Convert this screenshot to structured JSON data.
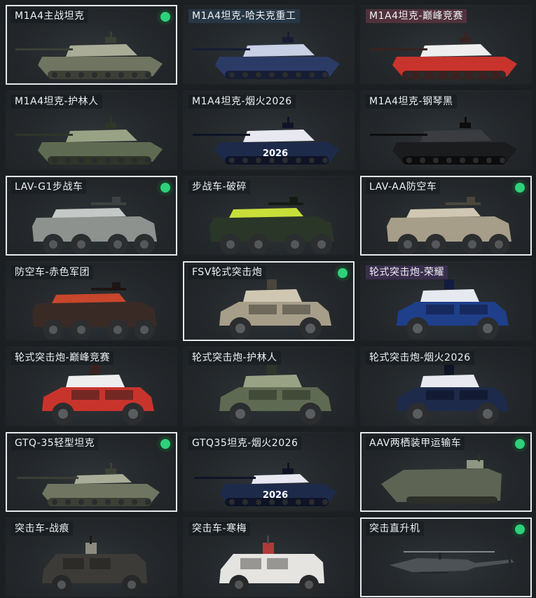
{
  "cards": [
    {
      "name": "M1A4主战坦克",
      "owned": true,
      "selected": true,
      "kind": "tank",
      "skin": "camo-green"
    },
    {
      "name": "M1A4坦克-哈夫克重工",
      "owned": false,
      "selected": false,
      "kind": "tank",
      "skin": "blue-stars",
      "tint": "blue"
    },
    {
      "name": "M1A4坦克-巅峰竞赛",
      "owned": false,
      "selected": false,
      "kind": "tank",
      "skin": "red-white",
      "tint": "pink"
    },
    {
      "name": "M1A4坦克-护林人",
      "owned": false,
      "selected": false,
      "kind": "tank",
      "skin": "forest"
    },
    {
      "name": "M1A4坦克-烟火2026",
      "owned": false,
      "selected": false,
      "kind": "tank",
      "skin": "fireworks",
      "badge": "2026"
    },
    {
      "name": "M1A4坦克-钢琴黑",
      "owned": false,
      "selected": false,
      "kind": "tank",
      "skin": "piano-black"
    },
    {
      "name": "LAV-G1步战车",
      "owned": true,
      "selected": true,
      "kind": "ifv",
      "skin": "grey"
    },
    {
      "name": "步战车-破碎",
      "owned": false,
      "selected": false,
      "kind": "ifv",
      "skin": "yellow-shatter"
    },
    {
      "name": "LAV-AA防空车",
      "owned": true,
      "selected": true,
      "kind": "ifv",
      "skin": "tan"
    },
    {
      "name": "防空车-赤色军团",
      "owned": false,
      "selected": false,
      "kind": "ifv",
      "skin": "red-legion"
    },
    {
      "name": "FSV轮式突击炮",
      "owned": true,
      "selected": true,
      "kind": "fsv",
      "skin": "tan"
    },
    {
      "name": "轮式突击炮-荣耀",
      "owned": false,
      "selected": false,
      "kind": "fsv",
      "skin": "blue-white",
      "tint": "purple"
    },
    {
      "name": "轮式突击炮-巅峰竞赛",
      "owned": false,
      "selected": false,
      "kind": "fsv",
      "skin": "red-white"
    },
    {
      "name": "轮式突击炮-护林人",
      "owned": false,
      "selected": false,
      "kind": "fsv",
      "skin": "forest"
    },
    {
      "name": "轮式突击炮-烟火2026",
      "owned": false,
      "selected": false,
      "kind": "fsv",
      "skin": "fireworks"
    },
    {
      "name": "GTQ-35轻型坦克",
      "owned": true,
      "selected": true,
      "kind": "light-tank",
      "skin": "camo-green"
    },
    {
      "name": "GTQ35坦克-烟火2026",
      "owned": false,
      "selected": false,
      "kind": "light-tank",
      "skin": "fireworks",
      "badge": "2026"
    },
    {
      "name": "AAV两栖装甲运输车",
      "owned": true,
      "selected": true,
      "kind": "aav",
      "skin": "green-grey"
    },
    {
      "name": "突击车-战痕",
      "owned": false,
      "selected": false,
      "kind": "assault",
      "skin": "scarred"
    },
    {
      "name": "突击车-寒梅",
      "owned": false,
      "selected": false,
      "kind": "assault",
      "skin": "white-plum"
    },
    {
      "name": "突击直升机",
      "owned": true,
      "selected": true,
      "kind": "heli",
      "skin": "dark-grey"
    }
  ],
  "skins": {
    "camo-green": {
      "body": "#6f7560",
      "accent": "#a9ad98",
      "dark": "#3c3f35"
    },
    "blue-stars": {
      "body": "#2c3a66",
      "accent": "#c8d0e6",
      "dark": "#161d34"
    },
    "red-white": {
      "body": "#c8342c",
      "accent": "#eeeeee",
      "dark": "#3a2220"
    },
    "forest": {
      "body": "#5f6a52",
      "accent": "#9aa286",
      "dark": "#2f3528"
    },
    "fireworks": {
      "body": "#1d2a4a",
      "accent": "#e8e8f0",
      "dark": "#0e1326"
    },
    "piano-black": {
      "body": "#1b1c1e",
      "accent": "#3a3c40",
      "dark": "#0c0c0d"
    },
    "grey": {
      "body": "#8d928f",
      "accent": "#c4c8c6",
      "dark": "#3e4240"
    },
    "yellow-shatter": {
      "body": "#2a3628",
      "accent": "#c8df3a",
      "dark": "#161c15"
    },
    "tan": {
      "body": "#a79e89",
      "accent": "#cfc7b2",
      "dark": "#4a463c"
    },
    "red-legion": {
      "body": "#3a2a26",
      "accent": "#c8462c",
      "dark": "#1e1614"
    },
    "blue-white": {
      "body": "#1f3f8a",
      "accent": "#e6e9ef",
      "dark": "#111d40"
    },
    "green-grey": {
      "body": "#5d6454",
      "accent": "#8f9683",
      "dark": "#2c3028"
    },
    "scarred": {
      "body": "#3c3b37",
      "accent": "#8d8a80",
      "dark": "#1c1b19"
    },
    "white-plum": {
      "body": "#e5e4e0",
      "accent": "#b03a3a",
      "dark": "#4a4846"
    },
    "dark-grey": {
      "body": "#4c5256",
      "accent": "#7f868a",
      "dark": "#22262a"
    }
  }
}
